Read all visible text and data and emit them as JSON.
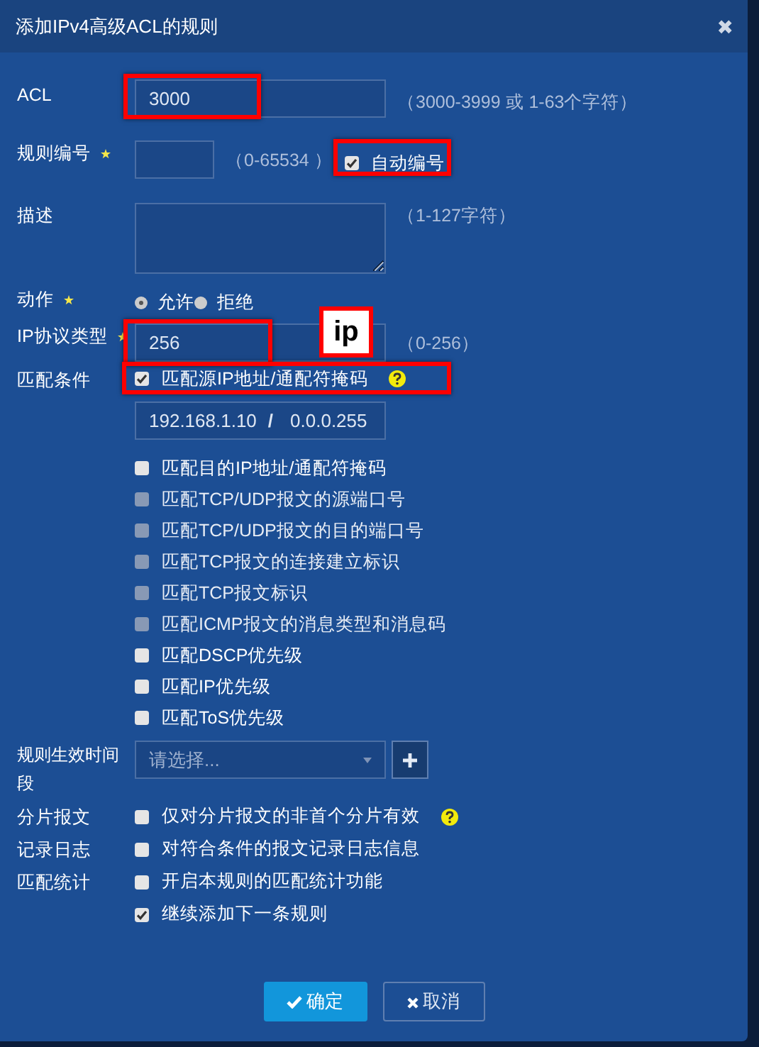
{
  "dialog": {
    "title": "添加IPv4高级ACL的规则",
    "close": "✖"
  },
  "acl": {
    "label": "ACL",
    "value": "3000",
    "hint": "（3000-3999 或 1-63个字符）",
    "highlighted": true
  },
  "rule_number": {
    "label": "规则编号",
    "required": true,
    "hint": "（0-65534 ）",
    "auto": {
      "label": "自动编号",
      "checked": true,
      "highlighted": true
    }
  },
  "description": {
    "label": "描述",
    "hint": "（1-127字符）"
  },
  "action": {
    "label": "动作",
    "required": true,
    "options": [
      {
        "label": "允许",
        "selected": true
      },
      {
        "label": "拒绝",
        "selected": false
      }
    ]
  },
  "protocol": {
    "label": "IP协议类型",
    "required": true,
    "value": "256",
    "hint": "（0-256）",
    "highlighted": true
  },
  "callout": {
    "text": "ip"
  },
  "match": {
    "label": "匹配条件",
    "conditions": [
      {
        "label": "匹配源IP地址/通配符掩码",
        "checked": true,
        "disabled": false,
        "help": true,
        "highlighted": true,
        "address": {
          "ip": "192.168.1.10",
          "separator": "/",
          "wildcard": "0.0.0.255"
        }
      },
      {
        "label": "匹配目的IP地址/通配符掩码",
        "checked": false,
        "disabled": false,
        "highlighted": false
      },
      {
        "label": "匹配TCP/UDP报文的源端口号",
        "checked": false,
        "disabled": true,
        "highlighted": false
      },
      {
        "label": "匹配TCP/UDP报文的目的端口号",
        "checked": false,
        "disabled": true,
        "highlighted": false
      },
      {
        "label": "匹配TCP报文的连接建立标识",
        "checked": false,
        "disabled": true,
        "highlighted": false
      },
      {
        "label": "匹配TCP报文标识",
        "checked": false,
        "disabled": true,
        "highlighted": false
      },
      {
        "label": "匹配ICMP报文的消息类型和消息码",
        "checked": false,
        "disabled": true,
        "highlighted": false
      },
      {
        "label": "匹配DSCP优先级",
        "checked": false,
        "disabled": false,
        "highlighted": false
      },
      {
        "label": "匹配IP优先级",
        "checked": false,
        "disabled": false,
        "highlighted": false
      },
      {
        "label": "匹配ToS优先级",
        "checked": false,
        "disabled": false,
        "highlighted": false
      }
    ]
  },
  "time_range": {
    "label": "规则生效时间段",
    "placeholder": "请选择..."
  },
  "options": [
    {
      "label": "分片报文",
      "text": "仅对分片报文的非首个分片有效",
      "checked": false,
      "help": true
    },
    {
      "label": "记录日志",
      "text": "对符合条件的报文记录日志信息",
      "checked": false
    },
    {
      "label": "匹配统计",
      "text": "开启本规则的匹配统计功能",
      "checked": false
    },
    {
      "text": "继续添加下一条规则",
      "checked": true
    }
  ],
  "buttons": [
    {
      "kind": "primary",
      "label": "确定"
    },
    {
      "kind": "secondary",
      "label": "取消"
    }
  ]
}
